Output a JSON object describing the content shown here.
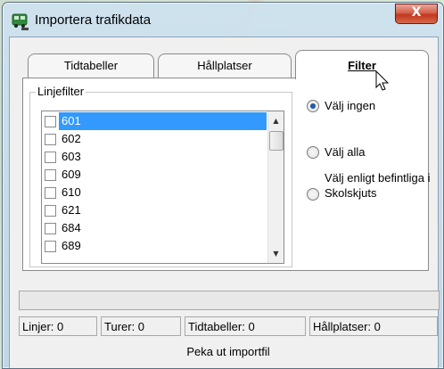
{
  "window": {
    "title": "Importera trafikdata",
    "close_label": "X"
  },
  "tabs": [
    {
      "label": "Tidtabeller",
      "active": false
    },
    {
      "label": "Hållplatser",
      "active": false
    },
    {
      "label": "Filter",
      "active": true
    }
  ],
  "filter": {
    "group_label": "Linjefilter",
    "lines": [
      {
        "label": "601",
        "checked": false,
        "selected": true
      },
      {
        "label": "602",
        "checked": false,
        "selected": false
      },
      {
        "label": "603",
        "checked": false,
        "selected": false
      },
      {
        "label": "609",
        "checked": false,
        "selected": false
      },
      {
        "label": "610",
        "checked": false,
        "selected": false
      },
      {
        "label": "621",
        "checked": false,
        "selected": false
      },
      {
        "label": "684",
        "checked": false,
        "selected": false
      },
      {
        "label": "689",
        "checked": false,
        "selected": false
      }
    ],
    "radio_options": [
      {
        "label": "Välj ingen",
        "selected": true
      },
      {
        "label": "Välj alla",
        "selected": false
      },
      {
        "label": "Välj enligt befintliga i Skolskjuts",
        "selected": false
      }
    ]
  },
  "status": {
    "linjer": "Linjer: 0",
    "turer": "Turer: 0",
    "tidtabeller": "Tidtabeller: 0",
    "hallplatser": "Hållplatser: 0"
  },
  "import_button": {
    "label": "Peka ut importfil"
  },
  "colors": {
    "selection": "#3399ff",
    "close_button": "#c8452e"
  }
}
